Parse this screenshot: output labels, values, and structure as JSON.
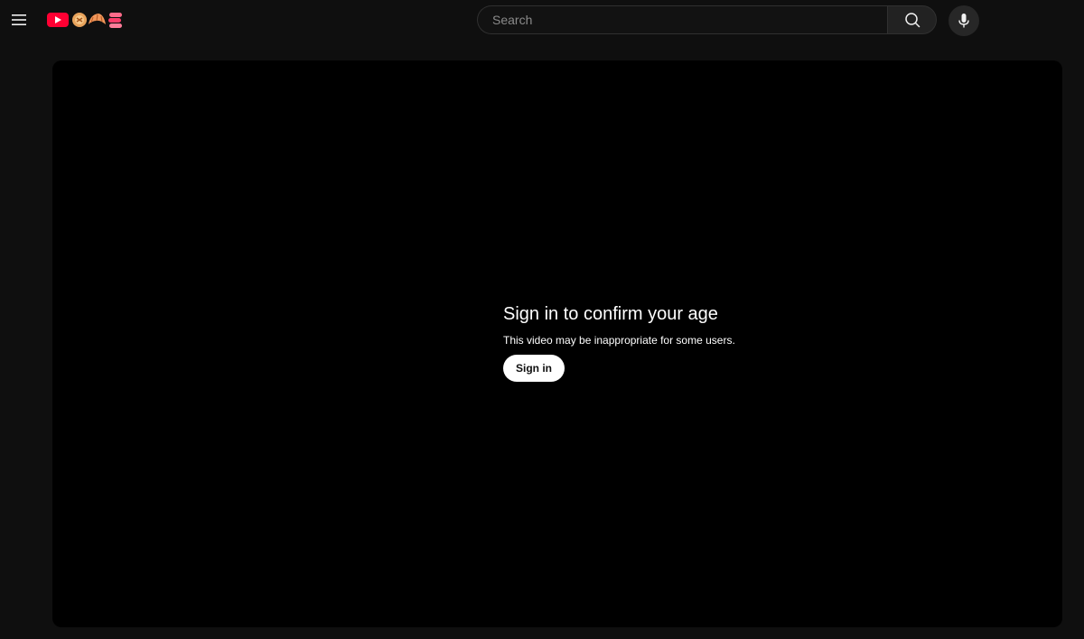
{
  "header": {
    "search": {
      "placeholder": "Search",
      "value": ""
    }
  },
  "player": {
    "gate_title": "Sign in to confirm your age",
    "gate_subtitle": "This video may be inappropriate for some users.",
    "signin_label": "Sign in"
  },
  "colors": {
    "background": "#0f0f0f",
    "player": "#000000",
    "brand_red": "#ff0033"
  },
  "icons": {
    "menu": "hamburger-menu-icon",
    "search": "search-icon",
    "mic": "microphone-icon"
  }
}
